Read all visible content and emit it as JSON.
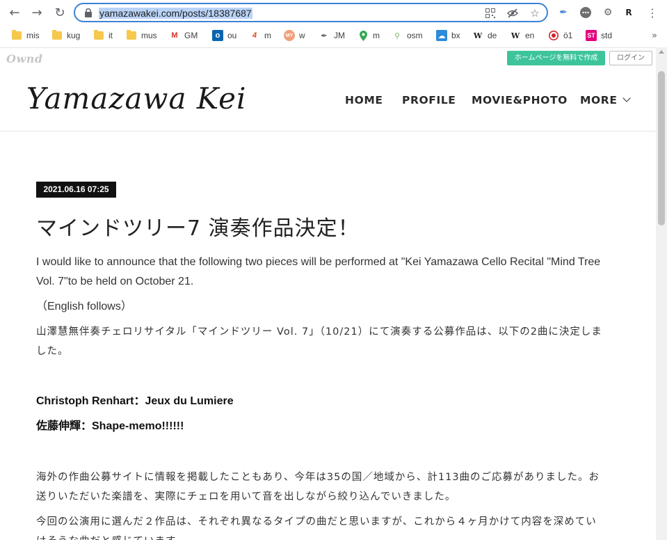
{
  "browser": {
    "url": "yamazawakei.com/posts/18387687",
    "bookmarks": [
      {
        "label": "mis",
        "icon": "folder-icon"
      },
      {
        "label": "kug",
        "icon": "folder-icon"
      },
      {
        "label": "it",
        "icon": "folder-icon"
      },
      {
        "label": "mus",
        "icon": "folder-icon"
      },
      {
        "label": "GM",
        "icon": "gmail-icon"
      },
      {
        "label": "ou",
        "icon": "outlook-icon"
      },
      {
        "label": "m",
        "icon": "four-icon"
      },
      {
        "label": "w",
        "icon": "my-icon"
      },
      {
        "label": "JM",
        "icon": "feather-icon"
      },
      {
        "label": "m",
        "icon": "maps-pin-icon"
      },
      {
        "label": "osm",
        "icon": "osm-icon"
      },
      {
        "label": "bx",
        "icon": "cloud-icon"
      },
      {
        "label": "de",
        "icon": "wikipedia-icon"
      },
      {
        "label": "en",
        "icon": "wikipedia-icon"
      },
      {
        "label": "ö1",
        "icon": "target-icon"
      },
      {
        "label": "std",
        "icon": "st-icon"
      }
    ]
  },
  "site": {
    "platform_logo": "Ownd",
    "create_button": "ホームページを無料で作成",
    "login_button": "ログイン",
    "logo": "Yamazawa Kei",
    "nav": {
      "home": "HOME",
      "profile": "PROFILE",
      "movie": "MOVIE&PHOTO",
      "more": "MORE"
    }
  },
  "post": {
    "date": "2021.06.16 07:25",
    "title": "マインドツリー7 演奏作品決定！",
    "intro_line1": "I would like to announce that the following two pieces will be performed at \"Kei Yamazawa Cello Recital \"Mind Tree",
    "intro_line2": "Vol. 7\"to be held on October 21.",
    "english_follows": "（English follows）",
    "jp_line1": "山澤慧無伴奏チェロリサイタル「マインドツリー Vol. 7」（10/21）にて演奏する公募作品は、以下の2曲に決定しま",
    "jp_line2": "した。",
    "piece1": "Christoph Renhart：Jeux du Lumiere",
    "piece2": "佐藤伸輝：Shape-memo!!!!!!",
    "jp2_line1": "海外の作曲公募サイトに情報を掲載したこともあり、今年は35の国／地域から、計113曲のご応募がありました。お",
    "jp2_line2": "送りいただいた楽譜を、実際にチェロを用いて音を出しながら絞り込んでいきました。",
    "jp3_line1": "今回の公演用に選んだ２作品は、それぞれ異なるタイプの曲だと思いますが、これから４ヶ月かけて内容を深めてい",
    "jp3_line2": "けそうな曲だと感じています。"
  }
}
